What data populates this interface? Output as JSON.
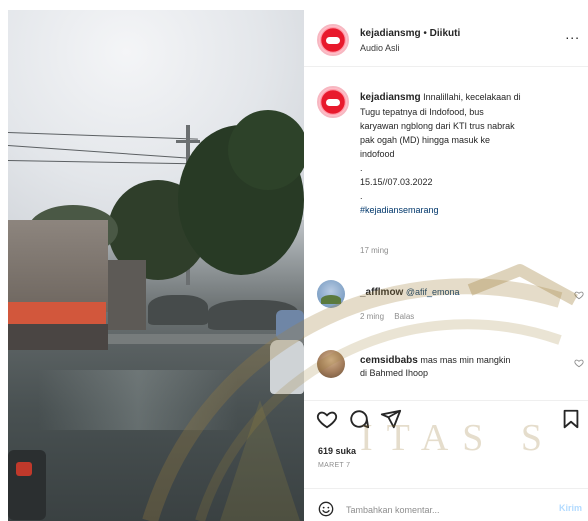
{
  "post": {
    "header": {
      "username": "kejadiansmg",
      "separator": "•",
      "follow_label": "Diikuti",
      "audio_label": "Audio Asli",
      "more_label": "..."
    },
    "caption": {
      "username": "kejadiansmg",
      "lines": [
        "Innalillahi, kecelakaan di",
        "Tugu tepatnya di Indofood, bus",
        "karyawan ngblong dari KTI trus nabrak",
        "pak ogah (MD) hingga masuk ke",
        "indofood",
        ".",
        "15.15//07.03.2022",
        "."
      ],
      "hashtag": "#kejadiansemarang",
      "time_ago": "17 ming"
    },
    "comments": [
      {
        "username": "_afflmow",
        "mention": "@afif_emona",
        "text": "",
        "meta_time": "2 ming",
        "meta_reply": "Balas"
      },
      {
        "username": "cemsidbabs",
        "mention": "",
        "text_lines": [
          "mas mas min mangkin",
          "di Bahmed Ihoop"
        ]
      }
    ],
    "likes": "619 suka",
    "date_small": "MARET 7",
    "add_comment": {
      "placeholder": "Tambahkan komentar...",
      "post_label": "Kirim"
    }
  },
  "watermark": {
    "text": "ITAS S"
  },
  "colors": {
    "avatar_red": "#e8192c",
    "link_blue": "#00376b",
    "muted": "#8e8e8e",
    "watermark_gold": "#967832"
  },
  "icons": {
    "like": "heart-outline",
    "comment": "speech-bubble",
    "share": "paper-plane",
    "save": "bookmark",
    "emoji": "smiley"
  }
}
